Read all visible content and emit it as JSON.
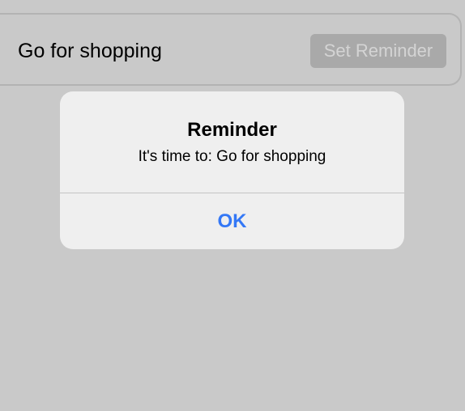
{
  "task": {
    "name": "Go for shopping",
    "set_reminder_label": "Set Reminder"
  },
  "alert": {
    "title": "Reminder",
    "message": "It's time to: Go for shopping",
    "ok_label": "OK"
  },
  "colors": {
    "background": "#c9c9c9",
    "alert_background": "#efefef",
    "accent": "#3478f6",
    "disabled_button": "#a9a9a9"
  }
}
